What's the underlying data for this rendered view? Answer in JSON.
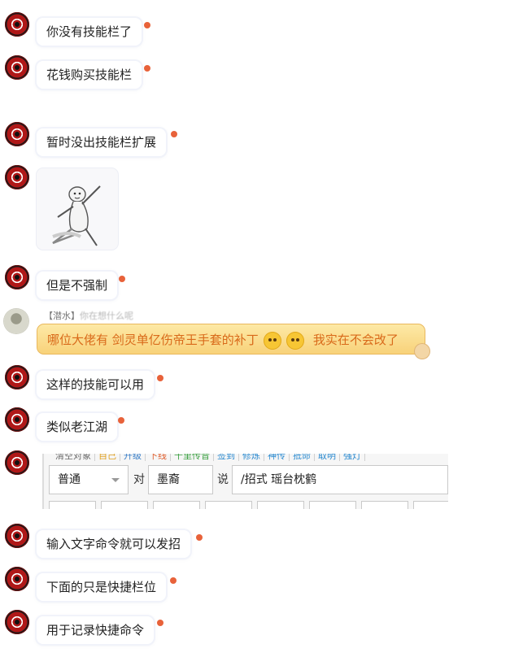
{
  "messages": [
    {
      "text": "你没有技能栏了"
    },
    {
      "text": "花钱购买技能栏"
    },
    {
      "text": "暂时没出技能栏扩展"
    },
    {
      "text": "但是不强制"
    },
    {
      "text": "这样的技能可以用"
    },
    {
      "text": "类似老江湖"
    },
    {
      "text": "输入文字命令就可以发招"
    },
    {
      "text": "下面的只是快捷栏位"
    },
    {
      "text": "用于记录快捷命令"
    }
  ],
  "gold_message": {
    "nick_tag": "【潜水】",
    "nick_name": "你在想什么呢",
    "text_before": "哪位大佬有 剑灵单亿伤帝王手套的补丁",
    "text_after": "我实在不会改了"
  },
  "embedded_ui": {
    "toolbar": [
      "清空对象",
      "自己",
      "升级",
      "下线",
      "千里传音",
      "签到",
      "修炼",
      "神传",
      "抵命",
      "取明",
      "强灯"
    ],
    "mode_select": "普通",
    "to_label": "对",
    "target": "墨裔",
    "say_label": "说",
    "command": "/招式 瑶台枕鹤"
  },
  "icons": {
    "avatar": "sharingan-avatar-icon",
    "error": "send-failed-icon"
  },
  "colors": {
    "error_dot": "#e8623a",
    "gold_text": "#d96a1a"
  }
}
